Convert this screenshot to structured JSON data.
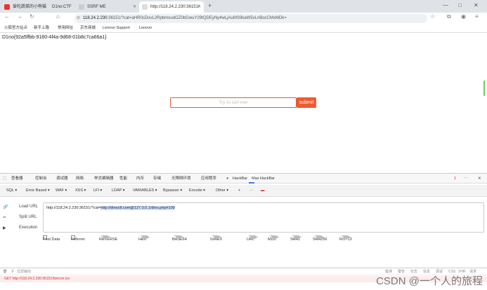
{
  "tabs": [
    {
      "label": "爱吃蔬菜的小熊猫"
    },
    {
      "label": "D1no:CTF"
    },
    {
      "label": "SSRF ME"
    },
    {
      "label": "http://118.24.2.230:36151/"
    }
  ],
  "address": {
    "url_host": "118.24.2.230",
    "url_rest": ":36151/?cat=aHR0cDovL2RpbmoudGZ0bGwuY29tQDEyNy4wLjAuMS9kaW5vLnBocCMxMDk=",
    "icon_names": [
      "back-icon",
      "forward-icon",
      "reload-icon",
      "home-icon",
      "lock-icon",
      "star-icon",
      "extensions-icon",
      "profile-icon",
      "menu-icon"
    ]
  },
  "bookmarks": [
    "火狐官方站点",
    "新手上路",
    "常用网址",
    "京东商城",
    "Lenovo Support",
    "Lenovo"
  ],
  "page": {
    "flag": "D1no{92a5ffbb-9180-4f4a-9d68-01b8c7ca66a1}",
    "search_placeholder": "Try to ssrf me!",
    "submit_label": "submit"
  },
  "devtools": {
    "tabs": [
      "查看器",
      "控制台",
      "调试器",
      "网络",
      "样式编辑器",
      "性能",
      "内存",
      "存储",
      "无障碍环境",
      "应用程序",
      "HackBar",
      "Max HackBar"
    ],
    "active_tab": "Max HackBar",
    "error_count": "1"
  },
  "hackbar": {
    "menus": [
      "SQL",
      "Error Based",
      "WAF",
      "XSS",
      "LFI",
      "LDAP",
      "VARIABLES",
      "Bypasser",
      "Encode",
      "Other"
    ],
    "actions": [
      "Load URL",
      "Split URL",
      "Execution"
    ],
    "url_prefix": "http://118.24.2.230:36151/?cat=",
    "url_selected": "http://dinoctf.com@127.0.0.1/dino.php#109",
    "checkboxes": [
      "Post Data",
      "Referrer"
    ],
    "encoders": [
      "REVERSE",
      "HEX",
      "BASE64",
      "0xHEX",
      "URL",
      "MD5",
      "SHA1",
      "SHA256",
      "ROT13"
    ]
  },
  "console": {
    "filter_placeholder": "过滤输出",
    "error_text": "GET http://118.24.2.230:36151/favicon.ico",
    "filters": [
      "错误",
      "警告",
      "日志",
      "信息",
      "调试",
      "CSS",
      "XHR",
      "请求"
    ]
  },
  "watermark": "CSDN @一个人的旅程"
}
